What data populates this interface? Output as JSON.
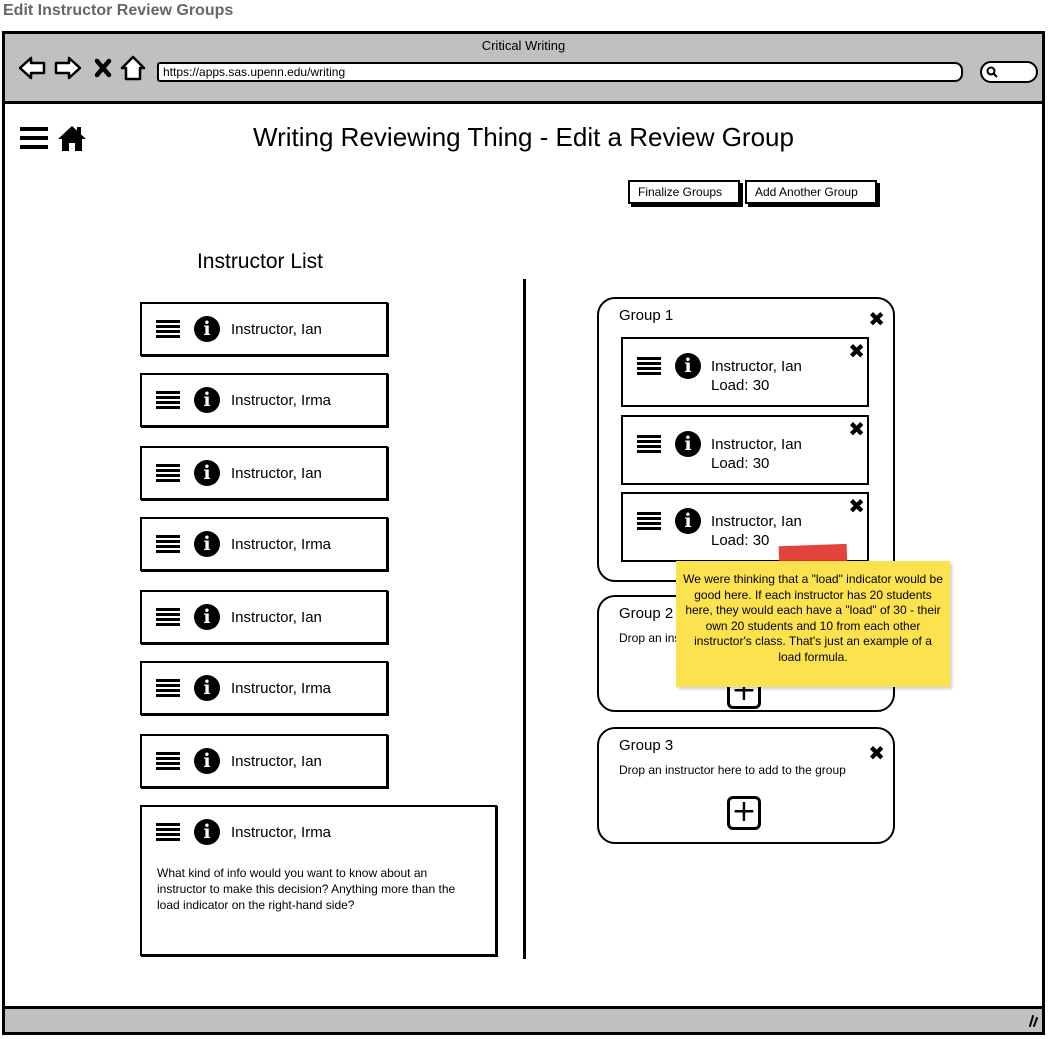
{
  "page_label": "Edit Instructor Review Groups",
  "browser": {
    "window_title": "Critical Writing",
    "url": "https://apps.sas.upenn.edu/writing",
    "icons": [
      "back-arrow-icon",
      "forward-arrow-icon",
      "stop-icon",
      "home-outline-icon",
      "search-icon"
    ]
  },
  "header": {
    "title": "Writing Reviewing Thing - Edit a Review Group",
    "icons": [
      "hamburger-menu-icon",
      "home-icon"
    ]
  },
  "toolbar": {
    "finalize_label": "Finalize Groups",
    "add_group_label": "Add Another Group"
  },
  "instructor_list": {
    "title": "Instructor List",
    "items": [
      {
        "name": "Instructor, Ian"
      },
      {
        "name": "Instructor, Irma"
      },
      {
        "name": "Instructor, Ian"
      },
      {
        "name": "Instructor, Irma"
      },
      {
        "name": "Instructor, Ian"
      },
      {
        "name": "Instructor, Irma"
      },
      {
        "name": "Instructor, Ian"
      },
      {
        "name": "Instructor, Irma",
        "note": "What kind of info would you want to know about an instructor to make this decision? Anything more than the load indicator on the right-hand side?"
      }
    ]
  },
  "groups": [
    {
      "title": "Group 1",
      "members": [
        {
          "name": "Instructor, Ian",
          "load": "Load: 30"
        },
        {
          "name": "Instructor, Ian",
          "load": "Load: 30"
        },
        {
          "name": "Instructor, Ian",
          "load": "Load: 30"
        }
      ]
    },
    {
      "title": "Group 2",
      "drop_hint": "Drop an instructor here to add to the group"
    },
    {
      "title": "Group 3",
      "drop_hint": "Drop an instructor here to add to the group"
    }
  ],
  "sticky_note": {
    "text": "We were thinking that a \"load\" indicator would be good here. If each instructor has 20 students here, they would each have a \"load\" of 30 - their own 20 students and 10 from each other instructor's class. That's just an example of a load formula.",
    "color": "#fde24f",
    "tape_color": "#e03a33"
  },
  "colors": {
    "chrome_gray": "#c0c0c0",
    "label_gray": "#666666"
  }
}
